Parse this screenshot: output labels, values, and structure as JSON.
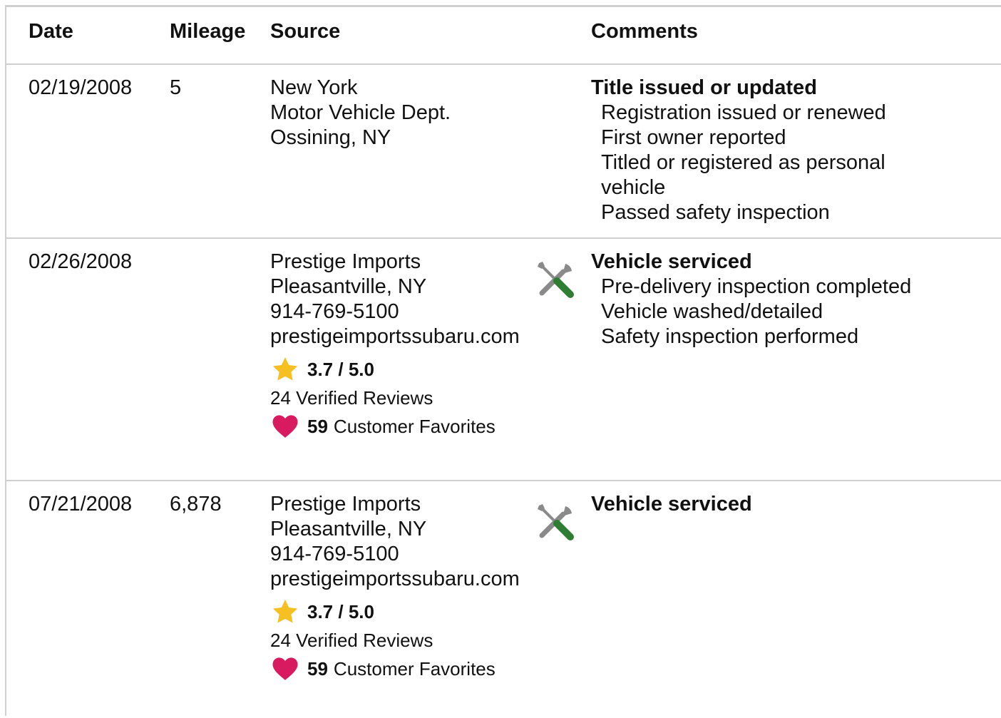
{
  "headers": {
    "date": "Date",
    "mileage": "Mileage",
    "source": "Source",
    "comments": "Comments"
  },
  "records": [
    {
      "date": "02/19/2008",
      "mileage": "5",
      "source": [
        "New York",
        "Motor Vehicle Dept.",
        "Ossining, NY"
      ],
      "comment_title": "Title issued or updated",
      "comment_items": [
        "Registration issued or renewed",
        "First owner reported",
        "Titled or registered as personal vehicle",
        "Passed safety inspection"
      ]
    },
    {
      "date": "02/26/2008",
      "mileage": "",
      "source": [
        "Prestige Imports",
        "Pleasantville, NY",
        "914-769-5100"
      ],
      "website": "prestigeimportssubaru.com",
      "rating": "3.7 / 5.0",
      "reviews": "24 Verified Reviews",
      "favorites_count": "59",
      "favorites_label": "Customer Favorites",
      "icon": "wrench-screwdriver-icon",
      "comment_title": "Vehicle serviced",
      "comment_items": [
        "Pre-delivery inspection completed",
        "Vehicle washed/detailed",
        "Safety inspection performed"
      ]
    },
    {
      "date": "07/21/2008",
      "mileage": "6,878",
      "source": [
        "Prestige Imports",
        "Pleasantville, NY",
        "914-769-5100"
      ],
      "website": "prestigeimportssubaru.com",
      "rating": "3.7 / 5.0",
      "reviews": "24 Verified Reviews",
      "favorites_count": "59",
      "favorites_label": "Customer Favorites",
      "icon": "wrench-screwdriver-icon",
      "comment_title": "Vehicle serviced",
      "comment_items": []
    }
  ],
  "colors": {
    "divider": "#cfcfcf",
    "star": "#f6c022",
    "heart": "#d81b60",
    "screwdriver_handle": "#2e7d32",
    "tool_metal": "#8a8a8a"
  }
}
